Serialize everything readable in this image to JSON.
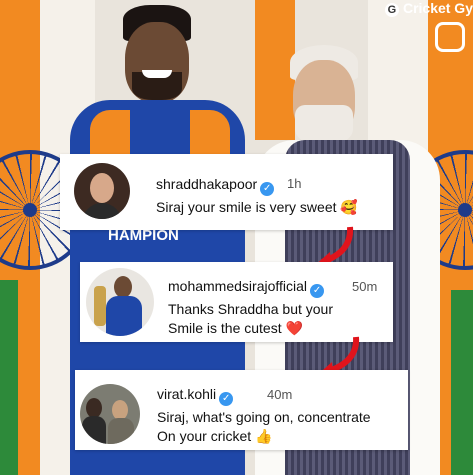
{
  "watermark": {
    "text": "Cricket Gy",
    "icon": "g-logo-icon"
  },
  "comments": [
    {
      "username": "shraddhakapoor",
      "verified": true,
      "time": "1h",
      "text": "Siraj your smile is very sweet 🥰",
      "avatar": "avatar-woman"
    },
    {
      "username": "mohammedsirajofficial",
      "verified": true,
      "time": "50m",
      "text_line1": "Thanks Shraddha but your",
      "text_line2": "Smile is the cutest ❤️",
      "avatar": "avatar-cricketer-trophy"
    },
    {
      "username": "virat.kohli",
      "verified": true,
      "time": "40m",
      "text_line1": "Siraj, what's going on, concentrate",
      "text_line2": "On your cricket 👍",
      "avatar": "avatar-man"
    }
  ],
  "jersey_text": "HAMPION",
  "colors": {
    "saffron": "#f28a21",
    "green": "#2d8a3a",
    "chakra": "#1e3b8a",
    "verified": "#3897f0",
    "arrow": "#e0141c",
    "jersey": "#1f47a8"
  }
}
